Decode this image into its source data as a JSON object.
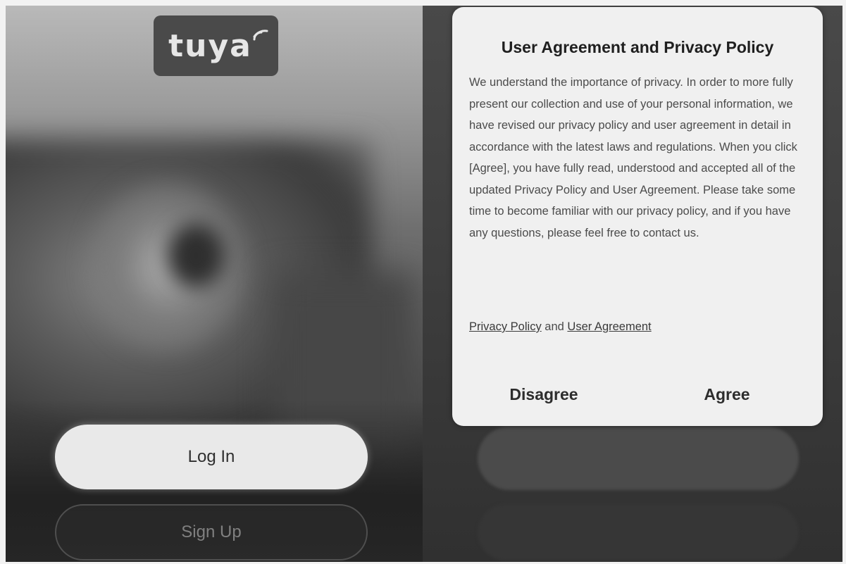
{
  "left_screen": {
    "logo_text": "tuya",
    "login_button": "Log In",
    "signup_button": "Sign Up"
  },
  "dialog": {
    "title": "User Agreement and Privacy Policy",
    "body": "We understand the importance of privacy. In order to more fully present our collection and use of your personal information, we have revised our privacy policy and user agreement in detail in accordance with the latest laws and regulations. When you click [Agree], you have fully read, understood and accepted all of the updated Privacy Policy and User Agreement. Please take some time to become familiar with our privacy policy, and if you have any questions, please feel free to contact us.",
    "privacy_policy_link": "Privacy Policy",
    "links_joiner": "and",
    "user_agreement_link": "User Agreement",
    "disagree_button": "Disagree",
    "agree_button": "Agree"
  },
  "colors": {
    "logo_background": "#4a4a4a",
    "dialog_background": "#f0f0f0",
    "login_button_background": "#e9e9e9"
  },
  "icons": {
    "logo_wave": "wifi-signal-icon"
  }
}
